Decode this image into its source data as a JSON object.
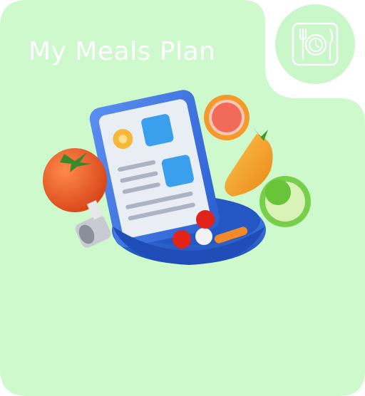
{
  "header": {
    "title": "My Meals Plan"
  },
  "badge": {
    "icon": "fork-plate-knife-icon"
  },
  "illustration": {
    "icon": "meal-plan-illustration"
  },
  "colors": {
    "card_bg": "#cdf9cc",
    "badge_bg": "#c9f7c9",
    "title_text": "#ffffff",
    "accent_blue": "#2f6fdd"
  }
}
